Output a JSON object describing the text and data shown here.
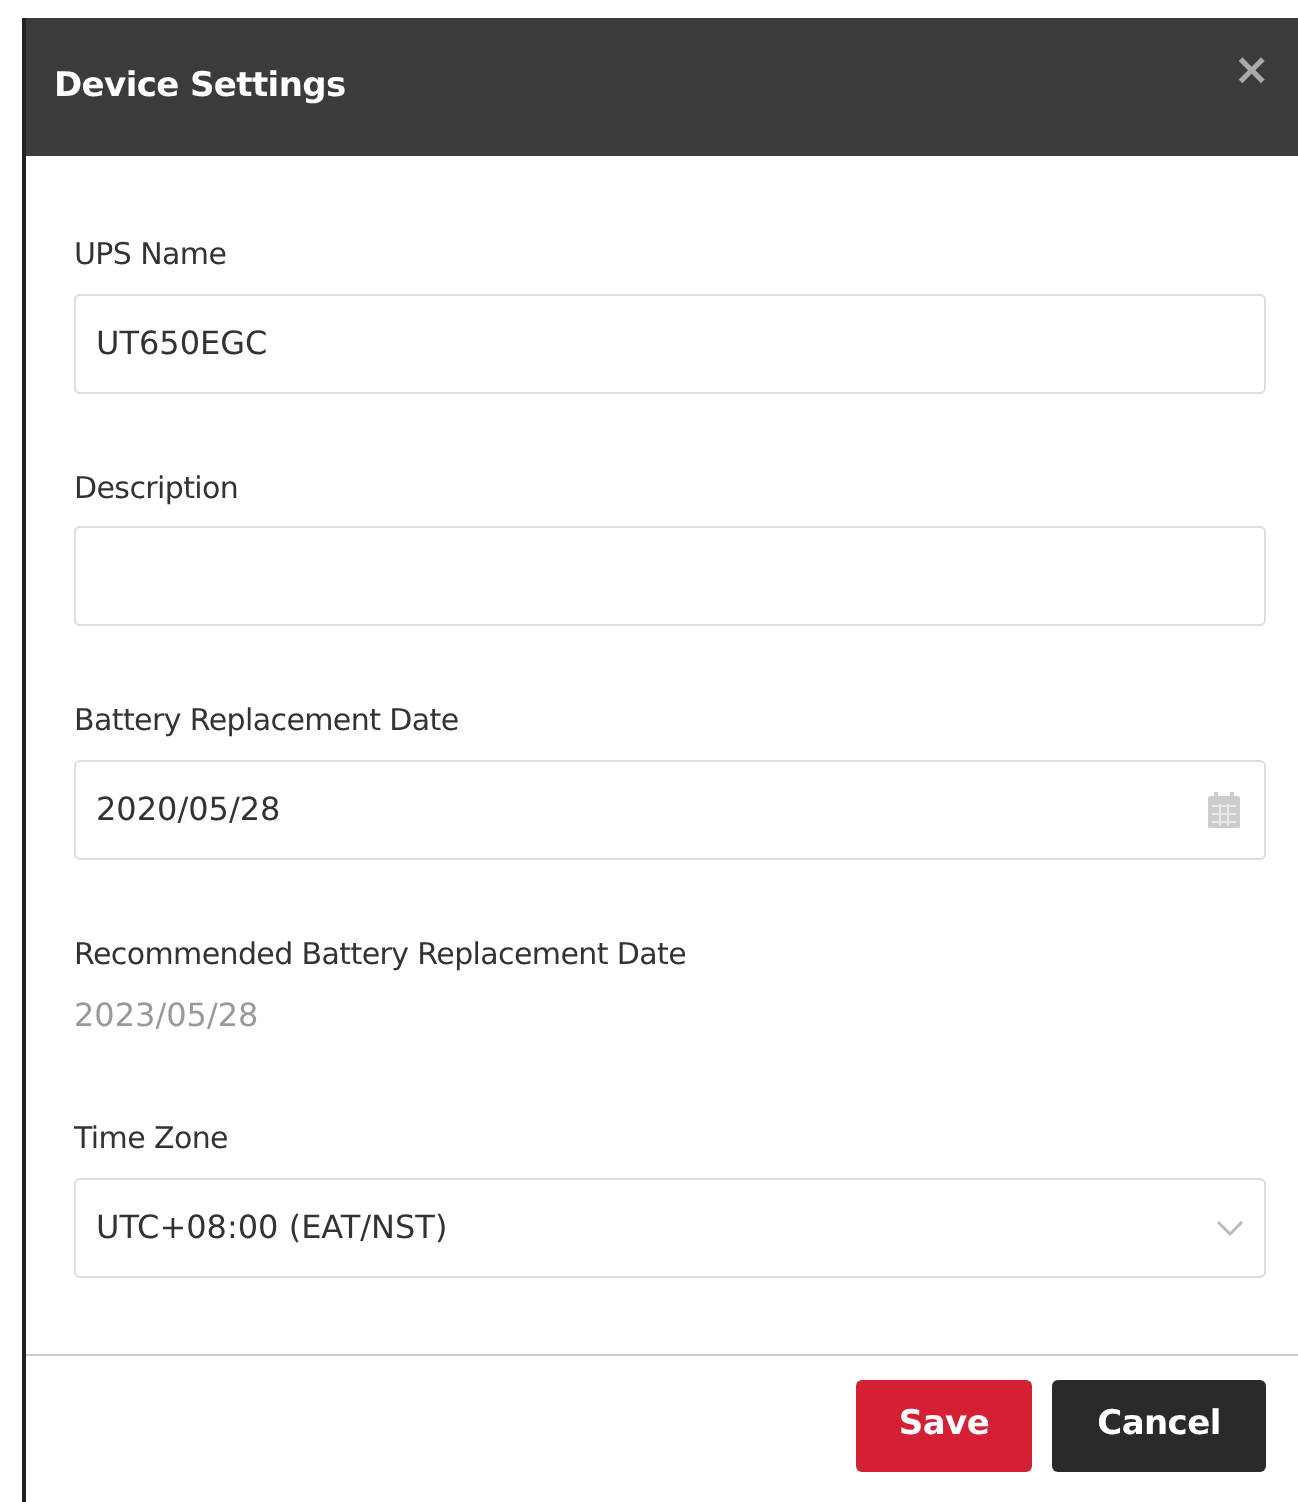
{
  "dialog": {
    "title": "Device Settings",
    "close": "×"
  },
  "fields": [
    {
      "kind": "text",
      "label": "UPS Name",
      "value": "UT650EGC"
    },
    {
      "kind": "text",
      "label": "Description"
    },
    {
      "kind": "date",
      "label": "Battery Replacement Date",
      "value": "2020/05/28"
    },
    {
      "kind": "readonly",
      "label": "Recommended Battery Replacement Date",
      "value": "2023/05/28"
    },
    {
      "kind": "select",
      "label": "Time Zone",
      "value": "UTC+08:00 (EAT/NST)"
    }
  ],
  "buttons": [
    {
      "kind": "primary",
      "label": "Save"
    },
    {
      "kind": "secondary",
      "label": "Cancel"
    }
  ]
}
